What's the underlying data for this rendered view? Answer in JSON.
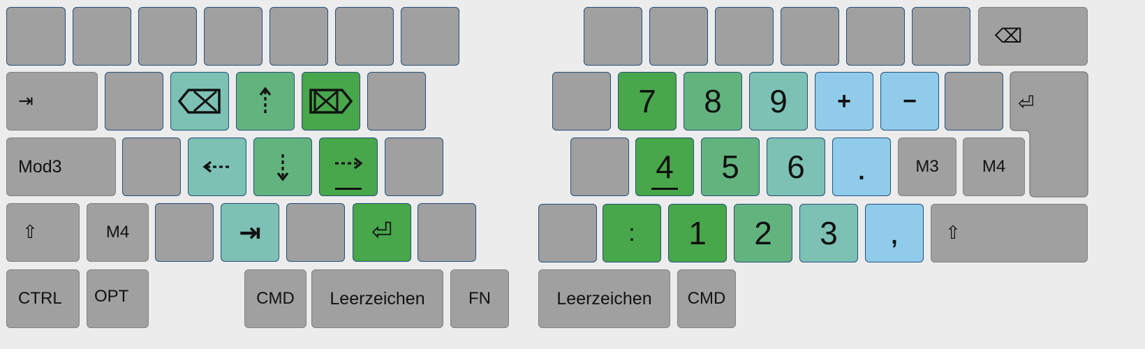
{
  "colors": {
    "gray": "#a0a0a0",
    "dark_green": "#48a64b",
    "mid_green": "#63b37f",
    "teal": "#7cc1b4",
    "light_blue": "#90cbea",
    "key_border": "#24507a",
    "mod_border": "#808080",
    "background": "#ececec"
  },
  "icons": {
    "tab": "tab-icon",
    "shift": "shift-icon",
    "backspace": "backspace-icon",
    "delete": "delete-icon",
    "enter": "enter-icon",
    "arrow_up": "dotted-arrow-up-icon",
    "arrow_down": "dotted-arrow-down-icon",
    "arrow_left": "dotted-arrow-left-icon",
    "arrow_right": "dotted-arrow-right-icon"
  },
  "labels": {
    "tab": "⇥",
    "mod3": "Mod3",
    "shift": "⇧",
    "m3": "M3",
    "m4": "M4",
    "ctrl": "CTRL",
    "opt": "OPT",
    "cmd": "CMD",
    "space": "Leerzeichen",
    "fn": "FN",
    "backspace": "⌫",
    "enter": "⏎",
    "tab_bold": "⇥",
    "plus": "+",
    "minus": "−",
    "dot": ".",
    "comma": ",",
    "colon": ":",
    "n1": "1",
    "n2": "2",
    "n3": "3",
    "n4": "4",
    "n5": "5",
    "n6": "6",
    "n7": "7",
    "n8": "8",
    "n9": "9"
  }
}
